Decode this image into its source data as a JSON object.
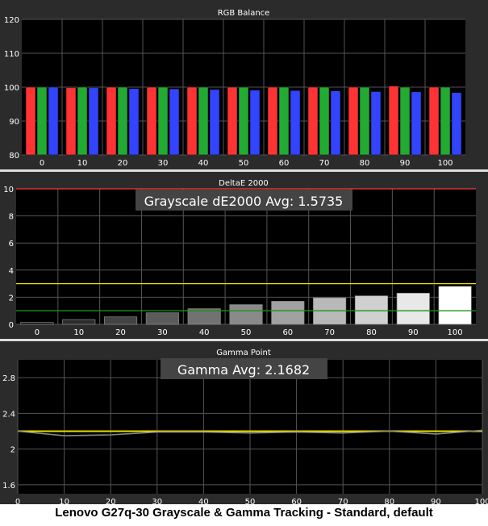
{
  "caption": "Lenovo G27q-30 Grayscale & Gamma Tracking - Standard, default",
  "colors": {
    "background": "#2b2b2b",
    "plot_background": "#000000",
    "grid": "#555555",
    "red": "#ff3333",
    "green": "#22aa33",
    "blue": "#3344ff",
    "reference_red": "#ff3b30",
    "threshold_yellow": "#e8e000",
    "threshold_green": "#1f8f1f",
    "gamma_target": "#e8e000",
    "gamma_measured": "#888888"
  },
  "chart_data": [
    {
      "type": "bar",
      "title": "RGB Balance",
      "categories": [
        "0",
        "10",
        "20",
        "30",
        "40",
        "50",
        "60",
        "70",
        "80",
        "90",
        "100"
      ],
      "ylim": [
        80,
        120
      ],
      "yticks": [
        80,
        90,
        100,
        110,
        120
      ],
      "series": [
        {
          "key": "red",
          "values": [
            100,
            99.8,
            100,
            100,
            100,
            100,
            100,
            100,
            100,
            100.3,
            100
          ]
        },
        {
          "key": "green",
          "values": [
            100,
            100,
            100,
            100,
            100,
            100,
            100,
            100,
            100,
            100,
            100
          ]
        },
        {
          "key": "blue",
          "values": [
            100,
            99.8,
            99.6,
            99.5,
            99.3,
            99.1,
            99.0,
            98.9,
            98.7,
            98.6,
            98.4
          ]
        }
      ]
    },
    {
      "type": "bar",
      "title": "DeltaE 2000",
      "annotation": "Grayscale dE2000 Avg: 1.5735",
      "categories": [
        "0",
        "10",
        "20",
        "30",
        "40",
        "50",
        "60",
        "70",
        "80",
        "90",
        "100"
      ],
      "ylim": [
        0,
        10
      ],
      "yticks": [
        0,
        2,
        4,
        6,
        8,
        10
      ],
      "values": [
        0.15,
        0.35,
        0.55,
        0.85,
        1.15,
        1.45,
        1.7,
        1.95,
        2.1,
        2.3,
        2.8
      ],
      "thresholds": [
        10,
        3,
        1
      ]
    },
    {
      "type": "line",
      "title": "Gamma Point",
      "annotation": "Gamma Avg: 2.1682",
      "x": [
        0,
        10,
        20,
        30,
        40,
        50,
        60,
        70,
        80,
        90,
        100
      ],
      "xticks": [
        0,
        10,
        20,
        30,
        40,
        50,
        60,
        70,
        80,
        90,
        100
      ],
      "xlim": [
        0,
        100
      ],
      "ylim": [
        1.5,
        3.0
      ],
      "yticks": [
        1.6,
        2,
        2.4,
        2.8
      ],
      "ytick_labels": [
        "1.6",
        "2",
        "2.4",
        "2.8"
      ],
      "target": 2.2,
      "values": [
        2.2,
        2.15,
        2.16,
        2.19,
        2.19,
        2.18,
        2.19,
        2.18,
        2.2,
        2.17,
        2.21
      ]
    }
  ]
}
